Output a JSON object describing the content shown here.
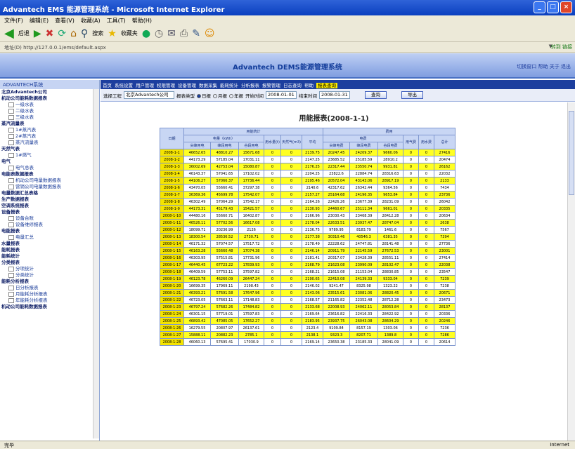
{
  "window": {
    "title": "Advantech EMS 能源管理系统 - Microsoft Internet Explorer",
    "buttons": [
      "_",
      "□",
      "×"
    ]
  },
  "menu": [
    "文件(F)",
    "编辑(E)",
    "查看(V)",
    "收藏(A)",
    "工具(T)",
    "帮助(H)"
  ],
  "toolbar": {
    "back": "后退",
    "search": "搜索",
    "favorites": "收藏夹"
  },
  "address": {
    "label": "地址(D)",
    "value": "http://127.0.0.1/ems/default.aspx",
    "go": "转到",
    "links": "链接"
  },
  "app": {
    "title": "Advantech DEMS能源管理系统",
    "links": "切换窗口 帮助 关于 退出"
  },
  "sidebar": {
    "header": "ADVANTECH系统",
    "items": [
      {
        "l": 1,
        "t": "北京Advantech公司"
      },
      {
        "l": 1,
        "t": "机动公司能耗数据报表"
      },
      {
        "l": 2,
        "t": "一级水表"
      },
      {
        "l": 2,
        "t": "二级水表"
      },
      {
        "l": 2,
        "t": "三级水表"
      },
      {
        "l": 1,
        "t": "蒸汽流量表"
      },
      {
        "l": 2,
        "t": "1#蒸汽表"
      },
      {
        "l": 2,
        "t": "2#蒸汽表"
      },
      {
        "l": 2,
        "t": "蒸汽流量表"
      },
      {
        "l": 1,
        "t": "天然气表"
      },
      {
        "l": 2,
        "t": "1#燃气"
      },
      {
        "l": 1,
        "t": "电气"
      },
      {
        "l": 2,
        "t": "电气总表"
      },
      {
        "l": 1,
        "t": "电能表数据报表"
      },
      {
        "l": 2,
        "t": "机动公司电量数据报表"
      },
      {
        "l": 2,
        "t": "营销公司电量数据报表"
      },
      {
        "l": 1,
        "t": "电量数据汇总表格"
      },
      {
        "l": 1,
        "t": "生产数据报表"
      },
      {
        "l": 1,
        "t": "空调系统报表"
      },
      {
        "l": 1,
        "t": "设备报表"
      },
      {
        "l": 2,
        "t": "设备台账"
      },
      {
        "l": 2,
        "t": "设备维修报表"
      },
      {
        "l": 1,
        "t": "电能报表"
      },
      {
        "l": 2,
        "t": "电量汇总"
      },
      {
        "l": 1,
        "t": "水量报表"
      },
      {
        "l": 1,
        "t": "能耗报表"
      },
      {
        "l": 1,
        "t": "能耗统计"
      },
      {
        "l": 1,
        "t": "分类报表"
      },
      {
        "l": 2,
        "t": "分项统计"
      },
      {
        "l": 2,
        "t": "分类统计"
      },
      {
        "l": 1,
        "t": "能耗分析报表"
      },
      {
        "l": 2,
        "t": "日分析报表"
      },
      {
        "l": 2,
        "t": "月能耗分析报表"
      },
      {
        "l": 2,
        "t": "年能耗分析报表"
      },
      {
        "l": 1,
        "t": "机动公司能耗数据报表"
      }
    ]
  },
  "nav": {
    "items": [
      "首页",
      "系统设置",
      "用户管理",
      "权限管理",
      "设备管理",
      "数据采集",
      "能耗统计",
      "分析报表",
      "报警管理",
      "日志查询",
      "帮助"
    ],
    "current": "报表查询"
  },
  "filters": {
    "project_label": "选择工程",
    "project_value": "北京Advantech公司",
    "radio_label": "报表类型",
    "radios": [
      "日报",
      "月报",
      "年报"
    ],
    "start_label": "开始时间",
    "start": "2008-01-01",
    "end_label": "结束时间",
    "end": "2008-01-31",
    "query": "查询",
    "export": "导出"
  },
  "report": {
    "title": "用能报表(2008-1-1)",
    "group1": "用能统计",
    "group2": "费用",
    "sub1": "电量（kWh）",
    "sub2": "电费",
    "cols": [
      "日期",
      "尖峰用电",
      "峰段用电",
      "谷段用电",
      "用水量(t)",
      "天然气(m3)",
      "平均",
      "尖峰电费",
      "峰段电费",
      "谷段电费",
      "用气费",
      "用水费",
      "总计"
    ],
    "rows": [
      [
        "2008-1-1",
        "46652.65",
        "48810.27",
        "15671.68",
        "0",
        "0",
        "2139.75",
        "20247.45",
        "24209.37",
        "9660.06",
        "0",
        "0",
        "27416"
      ],
      [
        "2008-1-2",
        "44173.29",
        "57185.04",
        "17031.11",
        "0",
        "0",
        "2147.25",
        "23685.52",
        "25185.59",
        "28910.2",
        "0",
        "0",
        "20474"
      ],
      [
        "2008-1-3",
        "36002.69",
        "42753.04",
        "15080.87",
        "0",
        "0",
        "2176.25",
        "22317.44",
        "23550.74",
        "9931.81",
        "0",
        "0",
        "26162"
      ],
      [
        "2008-1-4",
        "46143.37",
        "57041.65",
        "17102.02",
        "0",
        "0",
        "2204.25",
        "23822.6",
        "22884.74",
        "28316.63",
        "0",
        "0",
        "22032"
      ],
      [
        "2008-1-5",
        "44106.27",
        "57066.37",
        "17736.44",
        "0",
        "0",
        "2195.46",
        "20572.04",
        "43143.06",
        "28917.19",
        "0",
        "0",
        "2133"
      ],
      [
        "2008-1-6",
        "43470.05",
        "55660.41",
        "37297.38",
        "0",
        "0",
        "2140.6",
        "42317.62",
        "26342.44",
        "9364.56",
        "0",
        "0",
        "7434"
      ],
      [
        "2008-1-7",
        "36369.36",
        "45699.78",
        "17542.07",
        "0",
        "0",
        "2157.27",
        "25164.68",
        "24196.35",
        "9653.84",
        "0",
        "0",
        "23736"
      ],
      [
        "2008-1-8",
        "46302.49",
        "57064.29",
        "17542.17",
        "0",
        "0",
        "2164.26",
        "22426.26",
        "23677.39",
        "28231.09",
        "0",
        "0",
        "26042"
      ],
      [
        "2008-1-9",
        "44173.31",
        "45179.43",
        "15421.57",
        "0",
        "0",
        "2130.93",
        "24460.67",
        "25111.34",
        "9661.01",
        "0",
        "0",
        "20335"
      ],
      [
        "2008-1-10",
        "44480.16",
        "55660.71",
        "16402.87",
        "0",
        "0",
        "2166.96",
        "23030.43",
        "23468.39",
        "28412.28",
        "0",
        "0",
        "20634"
      ],
      [
        "2008-1-11",
        "46526.11",
        "57702.56",
        "16617.08",
        "0",
        "0",
        "2178.04",
        "22633.51",
        "23937.47",
        "28747.04",
        "0",
        "0",
        "2638"
      ],
      [
        "2008-1-12",
        "18099.71",
        "20236.99",
        "2126",
        "0",
        "0",
        "2136.75",
        "9789.95",
        "8183.79",
        "1461.6",
        "0",
        "0",
        "7567"
      ],
      [
        "2008-1-13",
        "18300.54",
        "28536.52",
        "2730.71",
        "0",
        "0",
        "2177.38",
        "30310.46",
        "40546.3",
        "6381.35",
        "0",
        "0",
        "7394"
      ],
      [
        "2008-1-14",
        "46171.32",
        "57074.57",
        "17517.72",
        "0",
        "0",
        "2178.49",
        "22228.62",
        "24747.81",
        "28141.48",
        "0",
        "0",
        "27736"
      ],
      [
        "2008-1-15",
        "46163.28",
        "55660.48",
        "17074.38",
        "0",
        "0",
        "2146.14",
        "20911.79",
        "22145.59",
        "27672.53",
        "0",
        "0",
        "23001"
      ],
      [
        "2008-1-16",
        "46303.95",
        "57515.81",
        "17731.96",
        "0",
        "0",
        "2181.41",
        "20317.07",
        "23428.39",
        "28551.11",
        "0",
        "0",
        "27414"
      ],
      [
        "2008-1-17",
        "46440.45",
        "67723.22",
        "17839.93",
        "0",
        "0",
        "2168.79",
        "21623.08",
        "23990.09",
        "28102.47",
        "0",
        "0",
        "22038"
      ],
      [
        "2008-1-18",
        "46409.59",
        "57753.11",
        "37597.82",
        "0",
        "0",
        "2168.21",
        "21615.08",
        "21153.04",
        "28830.85",
        "0",
        "0",
        "23547"
      ],
      [
        "2008-1-19",
        "46123.78",
        "46260.09",
        "26447.24",
        "0",
        "0",
        "2190.65",
        "22410.08",
        "24139.33",
        "9333.04",
        "0",
        "0",
        "7239"
      ],
      [
        "2008-1-20",
        "16699.35",
        "17969.11",
        "2198.43",
        "0",
        "0",
        "2146.02",
        "9241.47",
        "8325.98",
        "1323.22",
        "0",
        "0",
        "7238"
      ],
      [
        "2008-1-21",
        "46393.21",
        "57691.58",
        "17647.96",
        "0",
        "0",
        "2143.06",
        "23515.61",
        "23081.06",
        "28820.45",
        "0",
        "0",
        "20671"
      ],
      [
        "2008-1-22",
        "46723.05",
        "57663.11",
        "17148.83",
        "0",
        "0",
        "2168.57",
        "21165.82",
        "22352.48",
        "28712.28",
        "0",
        "0",
        "23473"
      ],
      [
        "2008-1-23",
        "46797.24",
        "57682.26",
        "17484.82",
        "0",
        "0",
        "2133.68",
        "22008.93",
        "24062.11",
        "28053.84",
        "0",
        "0",
        "28137"
      ],
      [
        "2008-1-24",
        "46301.15",
        "57719.01",
        "17597.83",
        "0",
        "0",
        "2169.64",
        "23616.82",
        "22416.33",
        "28422.92",
        "0",
        "0",
        "20336"
      ],
      [
        "2008-1-25",
        "46893.42",
        "47085.05",
        "17652.27",
        "0",
        "0",
        "2183.95",
        "23937.75",
        "26043.08",
        "28604.29",
        "0",
        "0",
        "20246"
      ],
      [
        "2008-1-26",
        "16279.55",
        "20807.97",
        "26137.61",
        "0",
        "0",
        "2123.4",
        "9109.84",
        "8157.19",
        "1303.06",
        "0",
        "0",
        "7236"
      ],
      [
        "2008-1-27",
        "15888.11",
        "20882.23",
        "2785.1",
        "0",
        "0",
        "2138.1",
        "9323.3",
        "8207.71",
        "1389.8",
        "0",
        "0",
        "7286"
      ],
      [
        "2008-1-28",
        "46060.13",
        "57695.41",
        "17030.9",
        "0",
        "0",
        "2169.14",
        "23650.38",
        "23185.33",
        "28041.09",
        "0",
        "0",
        "20614"
      ]
    ]
  },
  "status": {
    "left": "完毕",
    "zone": "Internet"
  }
}
